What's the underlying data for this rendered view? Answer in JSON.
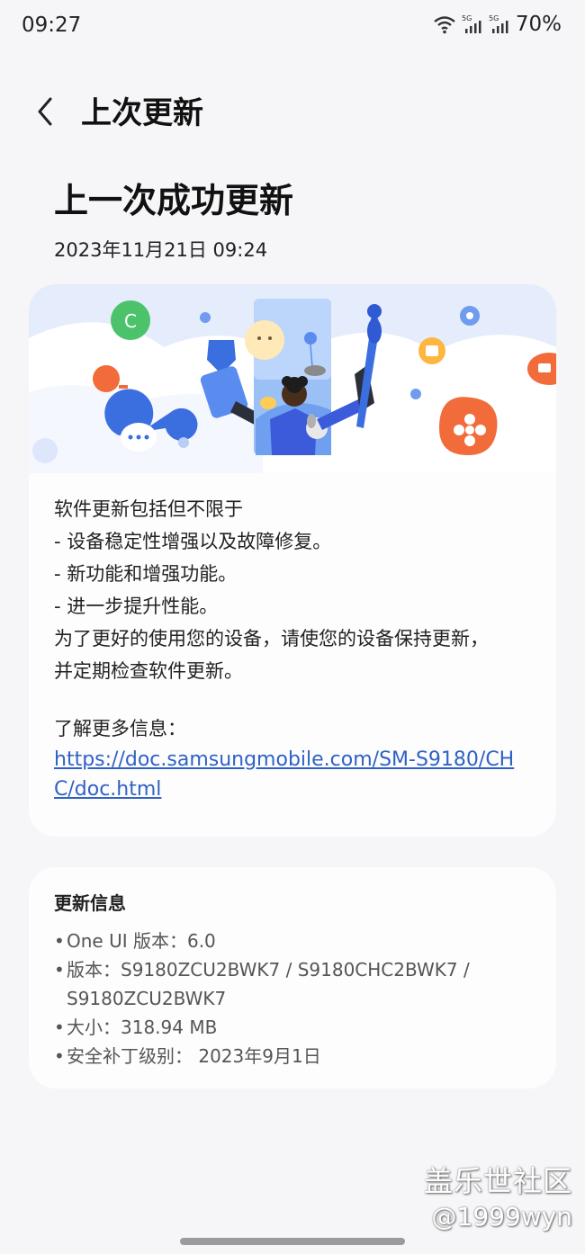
{
  "status_bar": {
    "time": "09:27",
    "battery": "70%"
  },
  "header": {
    "title": "上次更新"
  },
  "main": {
    "title": "上一次成功更新",
    "date": "2023年11月21日 09:24",
    "description_lines": [
      "软件更新包括但不限于",
      "- 设备稳定性增强以及故障修复。",
      "- 新功能和增强功能。",
      "- 进一步提升性能。",
      "为了更好的使用您的设备，请使您的设备保持更新，",
      "并定期检查软件更新。"
    ],
    "more_info_label": "了解更多信息：",
    "more_info_link": "https://doc.samsungmobile.com/SM-S9180/CHC/doc.html"
  },
  "update_info": {
    "heading": "更新信息",
    "items": [
      {
        "bullet": "•",
        "text": "One UI 版本：6.0"
      },
      {
        "bullet": "•",
        "text": "版本：S9180ZCU2BWK7 / S9180CHC2BWK7 / S9180ZCU2BWK7"
      },
      {
        "bullet": "•",
        "text": "大小：318.94 MB"
      },
      {
        "bullet": "•",
        "text": "安全补丁级别： 2023年9月1日"
      }
    ]
  },
  "watermark": {
    "line1": "盖乐世社区",
    "line2": "@1999wyn"
  },
  "colors": {
    "background": "#f6f5f8",
    "card": "#fdfdfe",
    "link": "#2f62c4",
    "accent_blue": "#3b6fe0",
    "accent_orange": "#f26b3a",
    "accent_green": "#4cc36b"
  },
  "icons": [
    "back-arrow-icon",
    "wifi-icon",
    "signal-5g-icon"
  ]
}
